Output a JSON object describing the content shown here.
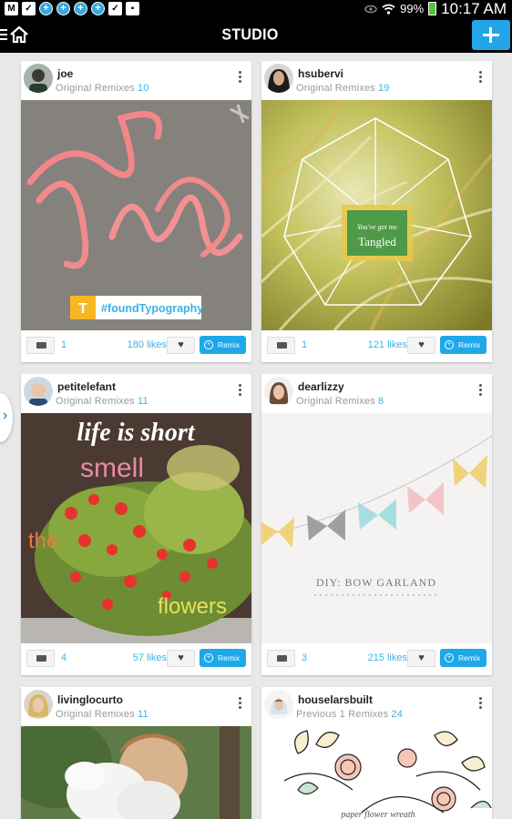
{
  "status_bar": {
    "battery": "99%",
    "time": "10:17 AM",
    "icons": [
      "gmail-icon",
      "check-icon",
      "sync-icon",
      "sync-icon",
      "sync-icon",
      "sync-icon",
      "check-icon",
      "briefcase-icon"
    ]
  },
  "header": {
    "title": "STUDIO",
    "add_icon": "plus-icon",
    "accent": "#22a6e8"
  },
  "cards": [
    {
      "user": "joe",
      "remix_label": "Original Remixes",
      "remix_count": "10",
      "comments": "1",
      "likes": "180 likes",
      "remix_button": "Remix",
      "caption_badge": "T",
      "caption": "#foundTypography"
    },
    {
      "user": "hsubervi",
      "remix_label": "Original Remixes",
      "remix_count": "19",
      "comments": "1",
      "likes": "121 likes",
      "remix_button": "Remix",
      "caption_small": "You've got me",
      "caption": "Tangled"
    },
    {
      "user": "petitelefant",
      "remix_label": "Original Remixes",
      "remix_count": "11",
      "comments": "4",
      "likes": "57 likes",
      "remix_button": "Remix",
      "text_top": "life is short",
      "text_mid": "smell",
      "text_the": "the",
      "text_bottom": "flowers"
    },
    {
      "user": "dearlizzy",
      "remix_label": "Original Remixes",
      "remix_count": "8",
      "comments": "3",
      "likes": "215 likes",
      "remix_button": "Remix",
      "caption": "DIY: BOW GARLAND"
    },
    {
      "user": "livinglocurto",
      "remix_label": "Original Remixes",
      "remix_count": "11"
    },
    {
      "user": "houselarsbuilt",
      "remix_label": "Previous 1 Remixes",
      "remix_count": "24",
      "caption": "paper flower wreath"
    }
  ]
}
